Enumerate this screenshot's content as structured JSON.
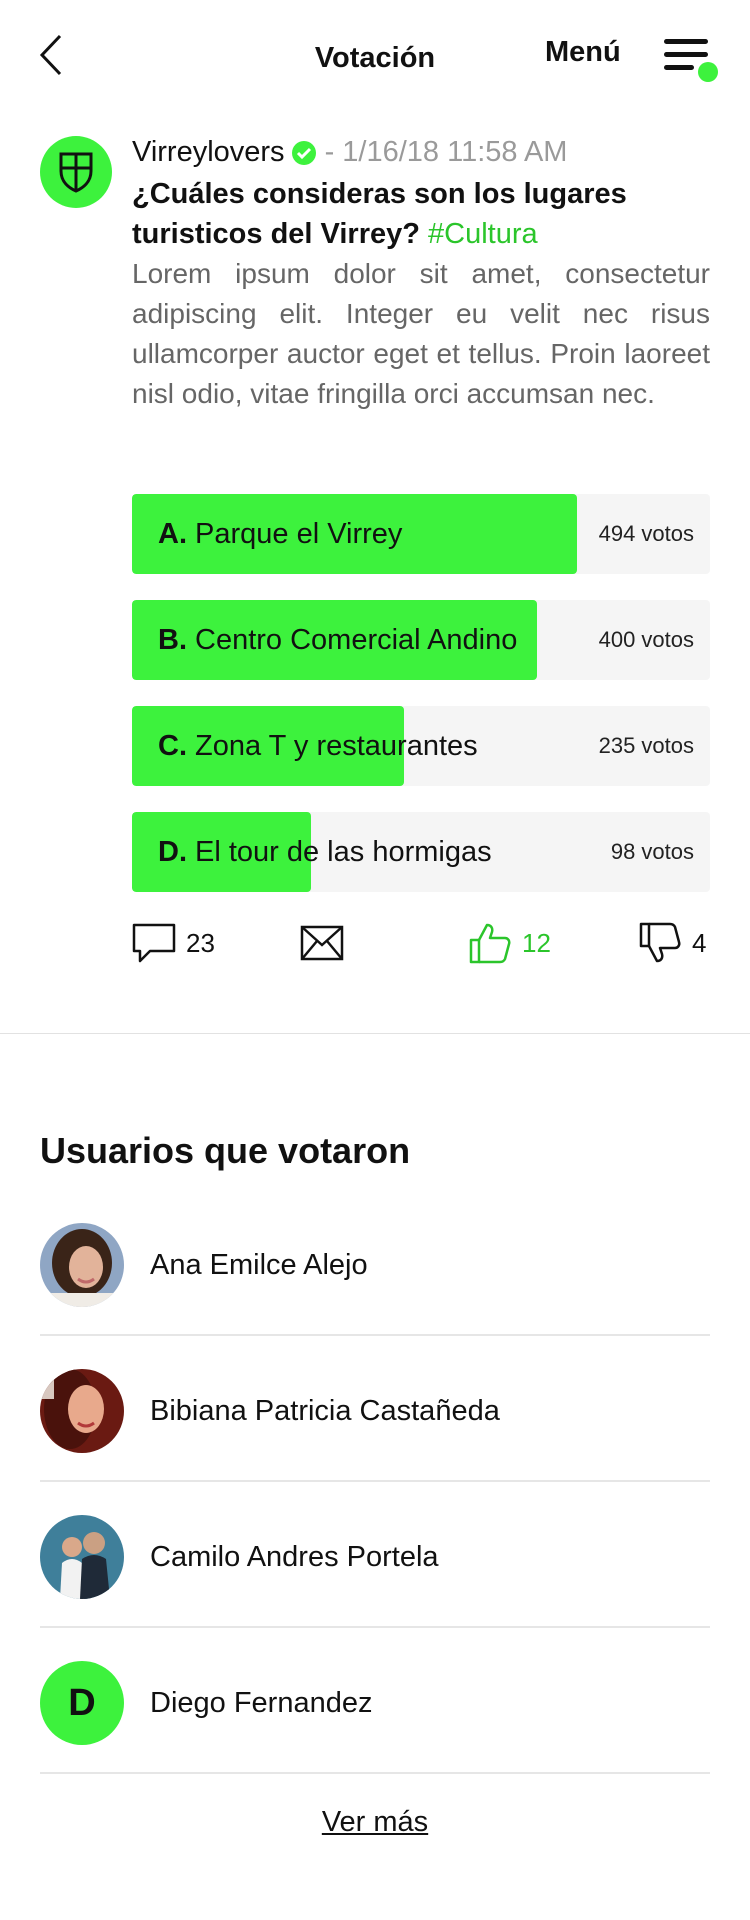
{
  "header": {
    "title": "Votación",
    "menu_label": "Menú"
  },
  "post": {
    "author": "Virreylovers",
    "date": "- 1/16/18 11:58 AM",
    "question": "¿Cuáles consideras son los lugares turisticos del Virrey?",
    "hashtag": "#Cultura",
    "body": "Lorem ipsum dolor sit amet, consectetur adipiscing elit. Integer eu velit nec risus ullamcorper auctor eget et tellus. Proin laoreet nisl odio, vitae fringilla orci accumsan nec."
  },
  "poll": {
    "options": [
      {
        "letter": "A.",
        "label": "Parque el Virrey",
        "votes": "494 votos",
        "fill_fraction": 0.77
      },
      {
        "letter": "B.",
        "label": "Centro Comercial Andino",
        "votes": "400 votos",
        "fill_fraction": 0.7
      },
      {
        "letter": "C.",
        "label": "Zona T y restaurantes",
        "votes": "235 votos",
        "fill_fraction": 0.47
      },
      {
        "letter": "D.",
        "label": "El tour de las hormigas",
        "votes": "98 votos",
        "fill_fraction": 0.31
      }
    ]
  },
  "actions": {
    "comments": "23",
    "likes": "12",
    "dislikes": "4"
  },
  "voters": {
    "title": "Usuarios que votaron",
    "users": [
      {
        "name": "Ana Emilce Alejo"
      },
      {
        "name": "Bibiana Patricia Castañeda"
      },
      {
        "name": "Camilo Andres Portela"
      },
      {
        "name": "Diego Fernandez",
        "initial": "D"
      }
    ],
    "more_label": "Ver más"
  },
  "colors": {
    "accent": "#3df23d",
    "accent_text": "#2bc52b",
    "muted": "#9a9a9a"
  },
  "icons": [
    "back-arrow-icon",
    "menu-icon",
    "shield-icon",
    "verified-icon",
    "comment-icon",
    "mail-icon",
    "thumbs-up-icon",
    "thumbs-down-icon"
  ]
}
